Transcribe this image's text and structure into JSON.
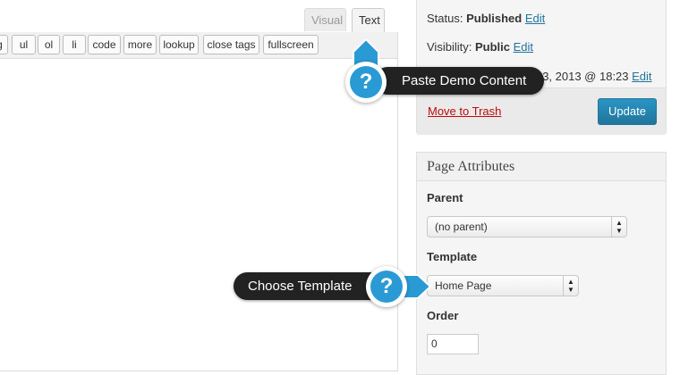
{
  "editor": {
    "tabs": {
      "visual": "Visual",
      "text": "Text"
    },
    "quicktags": [
      "g",
      "ul",
      "ol",
      "li",
      "code",
      "more",
      "lookup",
      "close tags",
      "fullscreen"
    ]
  },
  "publish": {
    "status_label": "Status:",
    "status_value": "Published",
    "visibility_label": "Visibility:",
    "visibility_value": "Public",
    "published_on": "Published on: May 3, 2013 @ 18:23",
    "edit": "Edit",
    "trash": "Move to Trash",
    "update": "Update"
  },
  "attributes": {
    "title": "Page Attributes",
    "parent_label": "Parent",
    "parent_value": "(no parent)",
    "template_label": "Template",
    "template_value": "Home Page",
    "order_label": "Order",
    "order_value": "0"
  },
  "tooltips": {
    "paste_demo": "Paste Demo Content",
    "choose_template": "Choose Template",
    "help_symbol": "?"
  },
  "colors": {
    "accent": "#2a9ad4",
    "link": "#21759b",
    "danger": "#bc0b0b",
    "tooltip_bg": "#222222"
  }
}
